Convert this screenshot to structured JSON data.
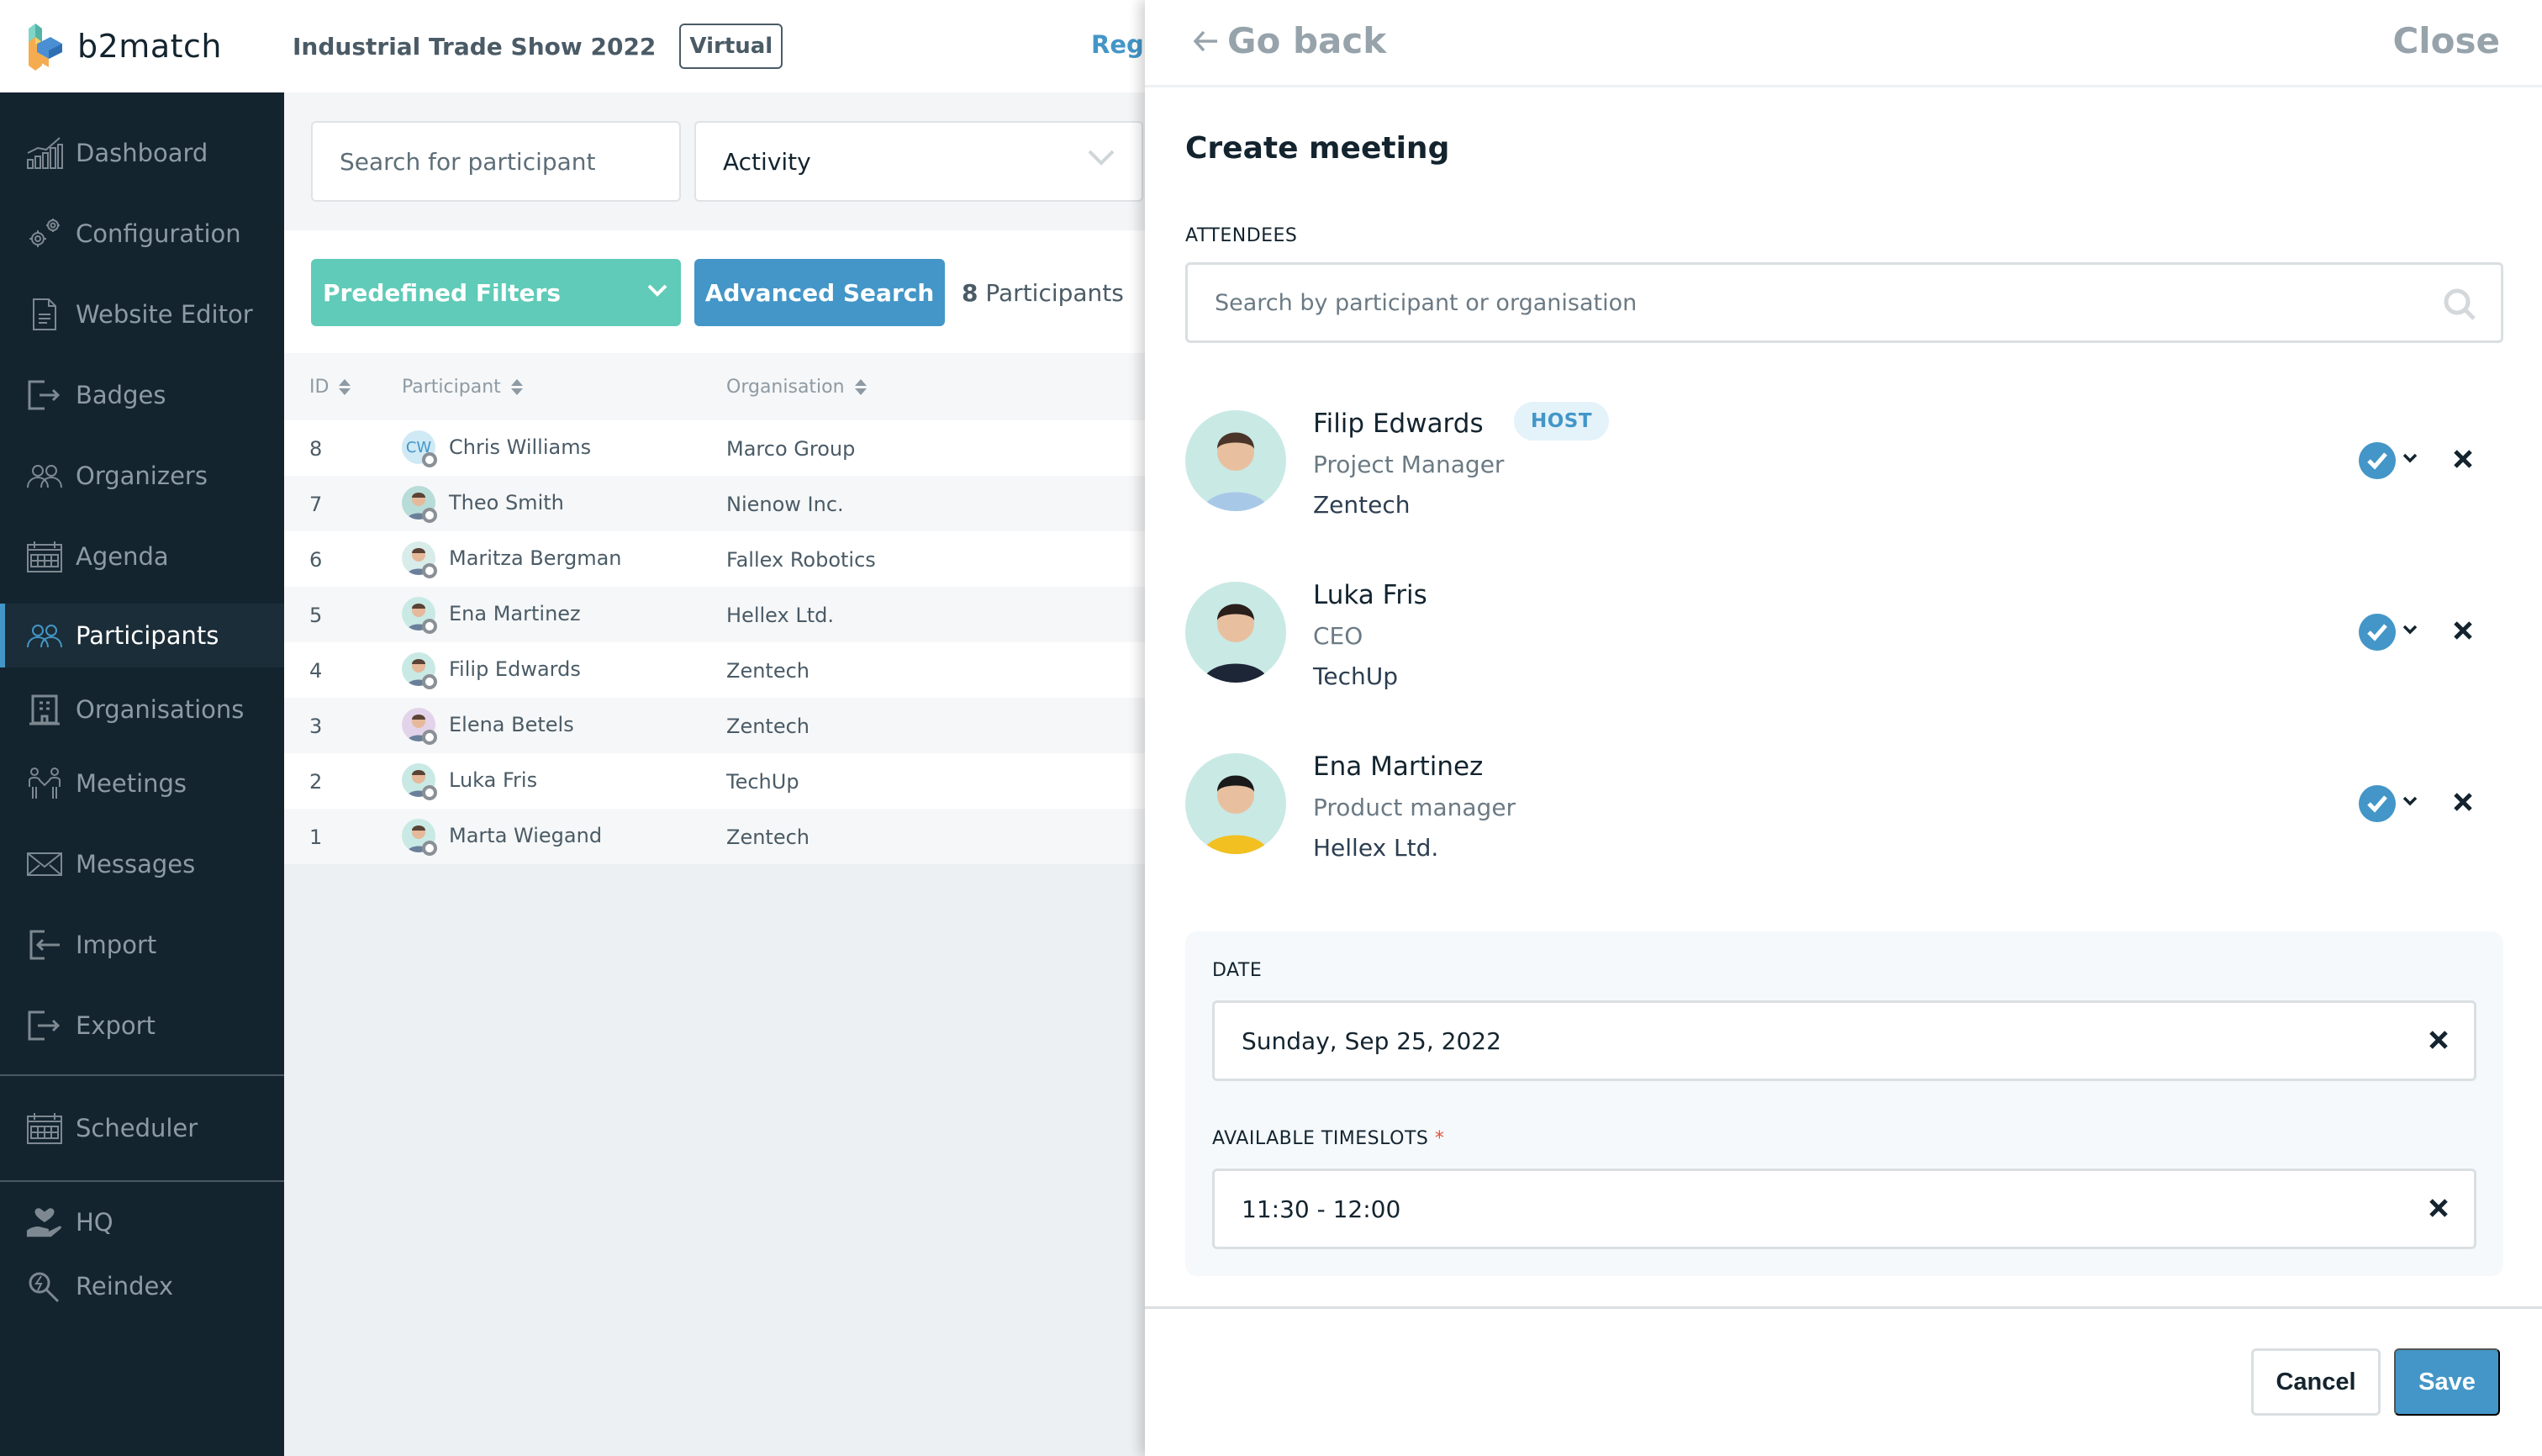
{
  "header": {
    "brand": "b2match",
    "event_title": "Industrial Trade Show 2022",
    "event_type_badge": "Virtual",
    "partial_link": "Regi"
  },
  "sidebar": {
    "items": [
      {
        "label": "Dashboard",
        "icon": "dashboard-chart-icon",
        "active": false
      },
      {
        "label": "Configuration",
        "icon": "gears-icon",
        "active": false
      },
      {
        "label": "Website Editor",
        "icon": "document-icon",
        "active": false
      },
      {
        "label": "Badges",
        "icon": "exit-arrow-icon",
        "active": false
      },
      {
        "label": "Organizers",
        "icon": "people-group-icon",
        "active": false
      },
      {
        "label": "Agenda",
        "icon": "calendar-icon",
        "active": false
      },
      {
        "label": "Participants",
        "icon": "people-group-icon",
        "active": true
      },
      {
        "label": "Organisations",
        "icon": "building-icon",
        "active": false
      },
      {
        "label": "Meetings",
        "icon": "handshake-people-icon",
        "active": false
      },
      {
        "label": "Messages",
        "icon": "envelope-icon",
        "active": false
      },
      {
        "label": "Import",
        "icon": "import-icon",
        "active": false
      },
      {
        "label": "Export",
        "icon": "export-icon",
        "active": false
      },
      {
        "label": "Scheduler",
        "icon": "calendar-icon",
        "active": false
      },
      {
        "label": "HQ",
        "icon": "heart-hand-icon",
        "active": false
      },
      {
        "label": "Reindex",
        "icon": "search-bolt-icon",
        "active": false
      }
    ]
  },
  "participants": {
    "search_placeholder": "Search for participant",
    "activity_select": "Activity",
    "predefined_filters_label": "Predefined Filters",
    "advanced_search_label": "Advanced Search",
    "count": "8",
    "count_label": "Participants",
    "columns": {
      "id": "ID",
      "participant": "Participant",
      "organisation": "Organisation"
    },
    "rows": [
      {
        "id": "8",
        "name": "Chris Williams",
        "organisation": "Marco Group",
        "initials": "CW"
      },
      {
        "id": "7",
        "name": "Theo Smith",
        "organisation": "Nienow Inc.",
        "initials": ""
      },
      {
        "id": "6",
        "name": "Maritza Bergman",
        "organisation": "Fallex Robotics",
        "initials": ""
      },
      {
        "id": "5",
        "name": "Ena Martinez",
        "organisation": "Hellex Ltd.",
        "initials": ""
      },
      {
        "id": "4",
        "name": "Filip Edwards",
        "organisation": "Zentech",
        "initials": ""
      },
      {
        "id": "3",
        "name": "Elena Betels",
        "organisation": "Zentech",
        "initials": ""
      },
      {
        "id": "2",
        "name": "Luka Fris",
        "organisation": "TechUp",
        "initials": ""
      },
      {
        "id": "1",
        "name": "Marta Wiegand",
        "organisation": "Zentech",
        "initials": ""
      }
    ]
  },
  "drawer": {
    "go_back": "Go back",
    "close": "Close",
    "title": "Create meeting",
    "attendees_label": "ATTENDEES",
    "attendee_search_placeholder": "Search by participant or organisation",
    "attendees": [
      {
        "name": "Filip Edwards",
        "role": "Project Manager",
        "organisation": "Zentech",
        "badge": "HOST",
        "confirmed": true
      },
      {
        "name": "Luka Fris",
        "role": "CEO",
        "organisation": "TechUp",
        "badge": "",
        "confirmed": true
      },
      {
        "name": "Ena Martinez",
        "role": "Product manager",
        "organisation": "Hellex Ltd.",
        "badge": "",
        "confirmed": true
      }
    ],
    "date_label": "DATE",
    "date_value": "Sunday, Sep 25, 2022",
    "timeslots_label": "AVAILABLE TIMESLOTS",
    "required_mark": "*",
    "timeslot_value": "11:30 - 12:00",
    "cancel_label": "Cancel",
    "save_label": "Save"
  },
  "colors": {
    "sidebar_bg": "#13242f",
    "accent_blue": "#4396c7",
    "teal": "#5fcbb8",
    "required": "#e5533b"
  }
}
